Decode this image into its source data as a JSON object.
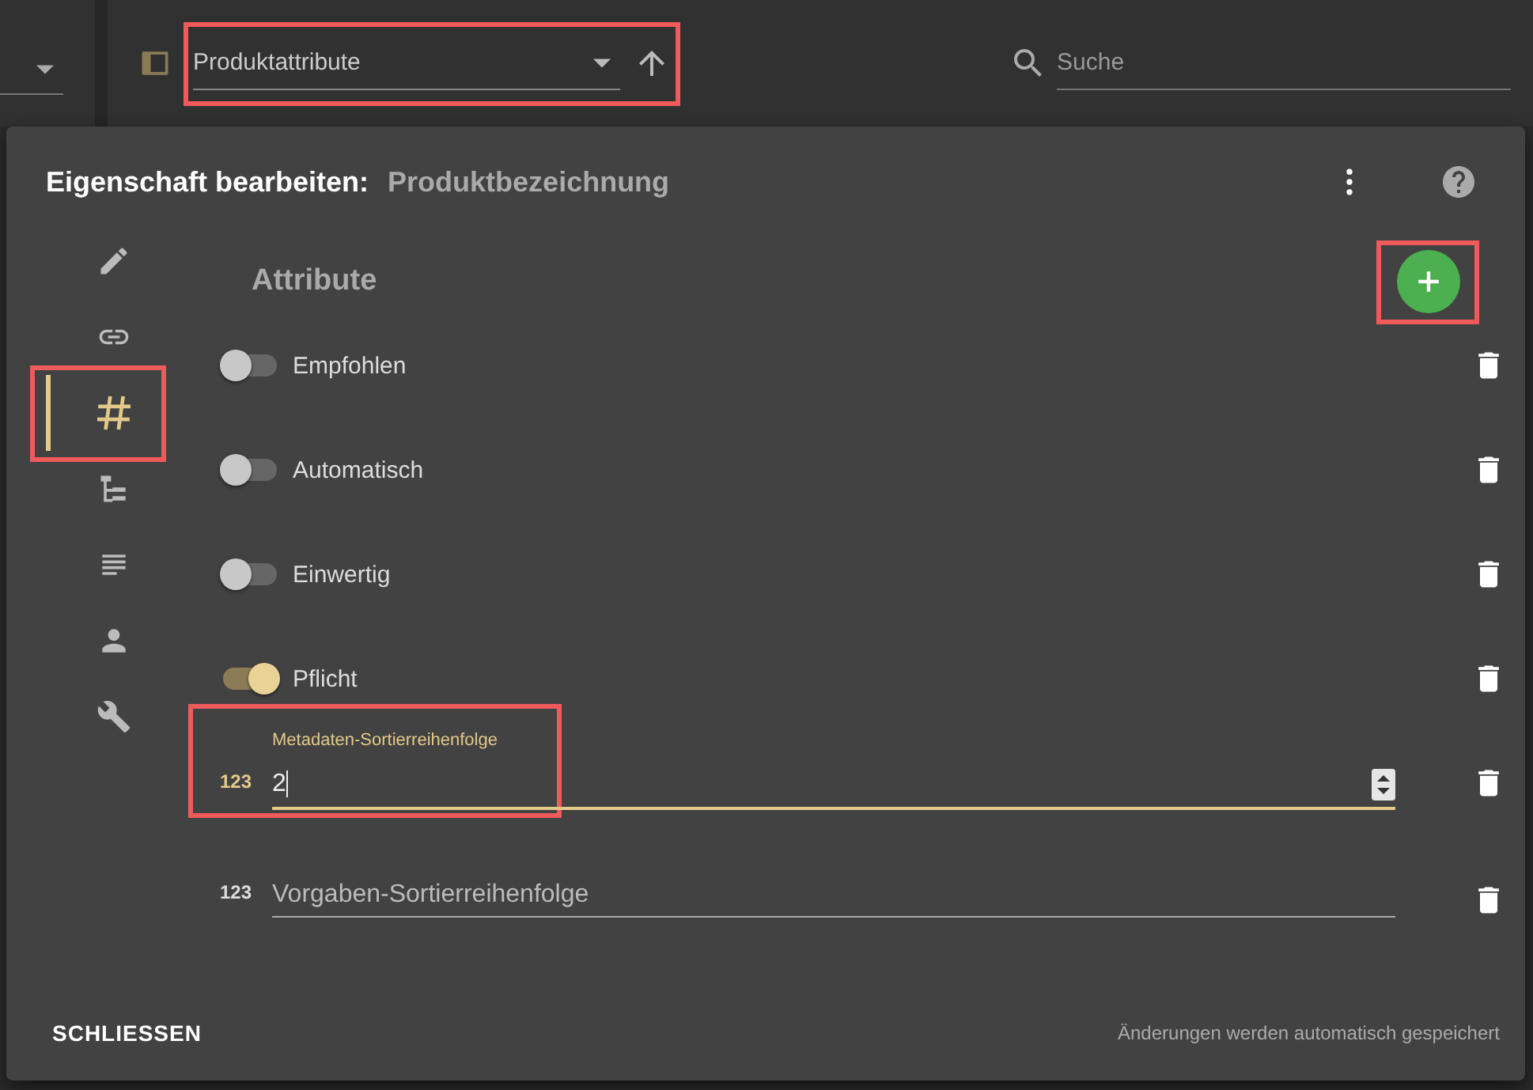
{
  "toolbar": {
    "category": {
      "value": "Produktattribute",
      "highlighted": true
    },
    "search": {
      "placeholder": "Suche"
    }
  },
  "dialog": {
    "title": "Eigenschaft bearbeiten:",
    "subject": "Produktbezeichnung",
    "nav": [
      {
        "selected": false,
        "highlighted": false
      },
      {
        "selected": false,
        "highlighted": false
      },
      {
        "selected": true,
        "highlighted": true
      },
      {
        "selected": false,
        "highlighted": false
      },
      {
        "selected": false,
        "highlighted": false
      },
      {
        "selected": false,
        "highlighted": false
      },
      {
        "selected": false,
        "highlighted": false
      }
    ],
    "section_title": "Attribute",
    "add_button": {
      "highlighted": true
    },
    "attributes": [
      {
        "kind": "toggle",
        "label": "Empfohlen",
        "on": false,
        "highlighted": false
      },
      {
        "kind": "toggle",
        "label": "Automatisch",
        "on": false,
        "highlighted": false
      },
      {
        "kind": "toggle",
        "label": "Einwertig",
        "on": false,
        "highlighted": false
      },
      {
        "kind": "toggle",
        "label": "Pflicht",
        "on": true,
        "highlighted": false
      },
      {
        "kind": "number",
        "icon_text": "123",
        "label": "Metadaten-Sortierreihenfolge",
        "value": "2",
        "focused": true,
        "highlighted": true
      },
      {
        "kind": "number",
        "icon_text": "123",
        "label": "Vorgaben-Sortierreihenfolge",
        "focused": false,
        "highlighted": false
      }
    ],
    "close_button": "SCHLIESSEN",
    "status": "Änderungen werden automatisch gespeichert"
  }
}
